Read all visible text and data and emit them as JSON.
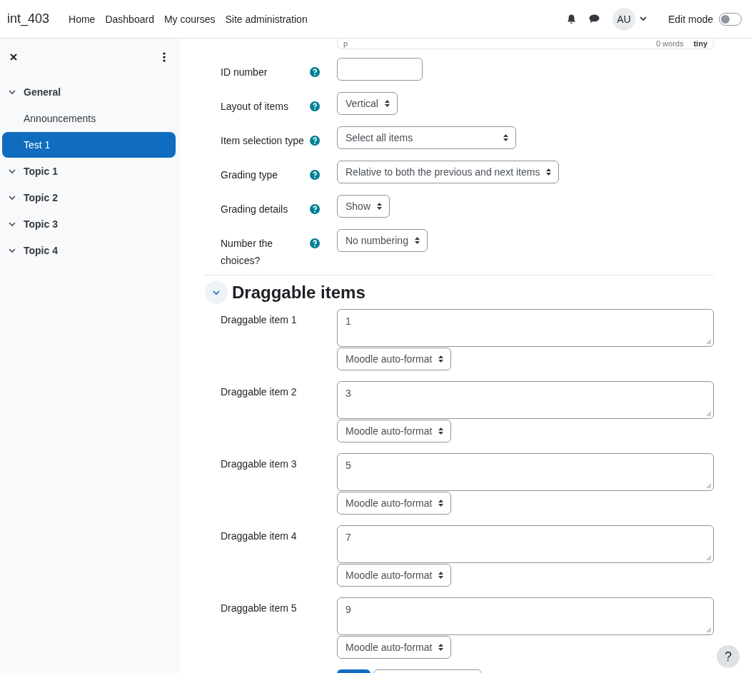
{
  "navbar": {
    "brand": "int_403",
    "links": [
      "Home",
      "Dashboard",
      "My courses",
      "Site administration"
    ],
    "avatar": "AU",
    "edit_mode": {
      "label": "Edit mode",
      "on": false
    }
  },
  "sidebar": {
    "items": [
      {
        "label": "General",
        "kind": "section",
        "expanded": true,
        "selected": false,
        "children": [
          {
            "label": "Announcements",
            "kind": "activity",
            "selected": false
          },
          {
            "label": "Test 1",
            "kind": "activity",
            "selected": true
          }
        ]
      },
      {
        "label": "Topic 1",
        "kind": "section",
        "expanded": true,
        "selected": false
      },
      {
        "label": "Topic 2",
        "kind": "section",
        "expanded": true,
        "selected": false
      },
      {
        "label": "Topic 3",
        "kind": "section",
        "expanded": true,
        "selected": false
      },
      {
        "label": "Topic 4",
        "kind": "section",
        "expanded": true,
        "selected": false
      }
    ]
  },
  "editor_footer": {
    "path": "p",
    "word_count": "0 words",
    "logo": "tiny"
  },
  "fields": [
    {
      "label": "ID number",
      "kind": "text"
    },
    {
      "label": "Layout of items",
      "kind": "select",
      "value": "Vertical"
    },
    {
      "label": "Item selection type",
      "kind": "select",
      "value": "Select all items"
    },
    {
      "label": "Grading type",
      "kind": "select",
      "value": "Relative to both the previous and next items"
    },
    {
      "label": "Grading details",
      "kind": "select",
      "value": "Show"
    },
    {
      "label": "Number the choices?",
      "kind": "select",
      "value": "No numbering"
    }
  ],
  "draggable_section": {
    "title": "Draggable items",
    "expanded": true,
    "items": [
      {
        "label": "Draggable item 1",
        "value": "1",
        "format": "Moodle auto-format"
      },
      {
        "label": "Draggable item 2",
        "value": "3",
        "format": "Moodle auto-format"
      },
      {
        "label": "Draggable item 3",
        "value": "5",
        "format": "Moodle auto-format"
      },
      {
        "label": "Draggable item 4",
        "value": "7",
        "format": "Moodle auto-format"
      },
      {
        "label": "Draggable item 5",
        "value": "9",
        "format": "Moodle auto-format"
      }
    ]
  },
  "help_button": "?"
}
